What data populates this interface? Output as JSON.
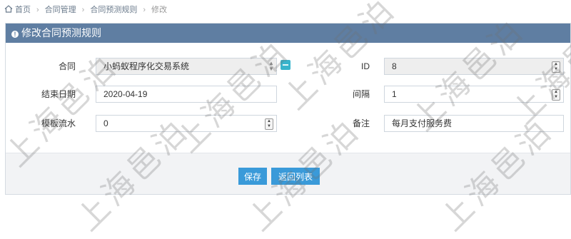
{
  "breadcrumb": {
    "items": [
      "首页",
      "合同管理",
      "合同预测规则",
      "修改"
    ]
  },
  "panel": {
    "title": "修改合同预测规则"
  },
  "form": {
    "contract": {
      "label": "合同",
      "value": "小蚂蚁程序化交易系统"
    },
    "id": {
      "label": "ID",
      "value": "8"
    },
    "end_date": {
      "label": "结束日期",
      "value": "2020-04-19"
    },
    "interval": {
      "label": "间隔",
      "value": "1"
    },
    "template_serial": {
      "label": "模板流水",
      "value": "0"
    },
    "remark": {
      "label": "备注",
      "value": "每月支付服务费"
    }
  },
  "buttons": {
    "save": "保存",
    "back": "返回列表"
  },
  "watermark": "上海邑泊",
  "colors": {
    "header": "#5f7ea2",
    "button": "#3a9ad9",
    "picker": "#38b4cc"
  }
}
